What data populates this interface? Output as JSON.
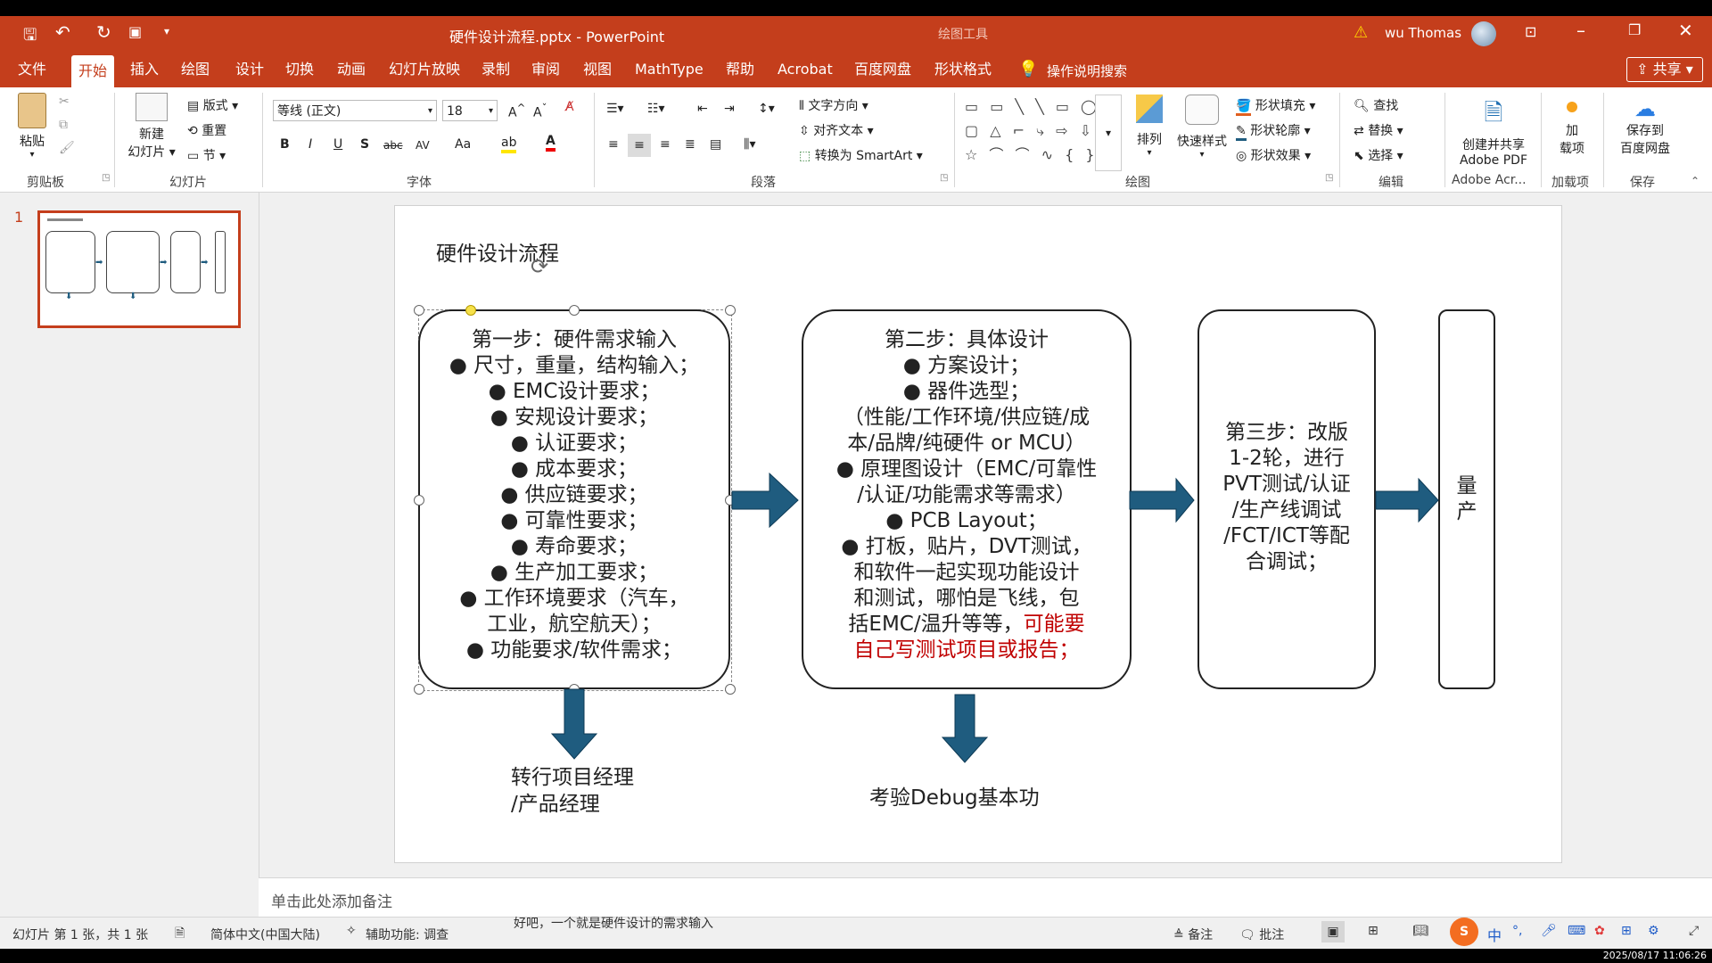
{
  "window": {
    "title": "硬件设计流程.pptx - PowerPoint",
    "context_tool": "绘图工具",
    "user": "wu Thomas",
    "qat": {
      "save": "save-icon",
      "undo": "undo-icon",
      "redo": "redo-icon"
    }
  },
  "tabs": [
    "文件",
    "开始",
    "插入",
    "绘图",
    "设计",
    "切换",
    "动画",
    "幻灯片放映",
    "录制",
    "审阅",
    "视图",
    "MathType",
    "帮助",
    "Acrobat",
    "百度网盘",
    "形状格式"
  ],
  "active_tab": "开始",
  "tell_me": "操作说明搜索",
  "share": "共享",
  "ribbon": {
    "clipboard": {
      "paste": "粘贴",
      "label": "剪贴板"
    },
    "slides": {
      "new_slide_1": "新建",
      "new_slide_2": "幻灯片",
      "layout": "版式",
      "reset": "重置",
      "section": "节",
      "label": "幻灯片"
    },
    "font": {
      "name": "等线 (正文)",
      "size": "18",
      "bold": "B",
      "italic": "I",
      "underline": "U",
      "shadow": "S",
      "strike": "abc",
      "spacing": "AV",
      "case": "Aa",
      "label": "字体"
    },
    "paragraph": {
      "text_direction": "文字方向",
      "align_text": "对齐文本",
      "smartart": "转换为 SmartArt",
      "label": "段落"
    },
    "drawing": {
      "arrange": "排列",
      "quick_styles": "快速样式",
      "fill": "形状填充",
      "outline": "形状轮廓",
      "effects": "形状效果",
      "label": "绘图"
    },
    "editing": {
      "find": "查找",
      "replace": "替换",
      "select": "选择",
      "label": "编辑"
    },
    "adobe": {
      "line1": "创建并共享",
      "line2": "Adobe PDF",
      "label": "Adobe Acr..."
    },
    "addins": {
      "line1": "加",
      "line2": "载项",
      "label": "加载项"
    },
    "save": {
      "line1": "保存到",
      "line2": "百度网盘",
      "label": "保存"
    }
  },
  "thumbnail": {
    "number": "1"
  },
  "slide": {
    "title": "硬件设计流程",
    "step1": {
      "lines": [
        "第一步：硬件需求输入",
        "●  尺寸，重量，结构输入；",
        "●  EMC设计要求；",
        "●  安规设计要求；",
        "●  认证要求；",
        "●  成本要求；",
        "●  供应链要求；",
        "●  可靠性要求；",
        "●  寿命要求；",
        "●  生产加工要求；",
        "●  工作环境要求（汽车，",
        "工业，航空航天）；",
        "●  功能要求/软件需求；"
      ]
    },
    "step2": {
      "lines": [
        "第二步：具体设计",
        "●  方案设计；",
        "●  器件选型；",
        "（性能/工作环境/供应链/成",
        "本/品牌/纯硬件 or MCU）",
        "●  原理图设计（EMC/可靠性",
        "/认证/功能需求等需求）",
        "●  PCB Layout；",
        "●  打板，贴片，DVT测试，",
        "和软件一起实现功能设计",
        "和测试，哪怕是飞线，包"
      ],
      "mixed_prefix": "括EMC/温升等等，",
      "mixed_red": "可能要",
      "last_red": "自己写测试项目或报告；",
      "red_color": "#C00000"
    },
    "step3": {
      "lines": [
        "第三步：改版",
        "1-2轮，进行",
        "PVT测试/认证",
        "/生产线调试",
        "/FCT/ICT等配",
        "合调试；"
      ]
    },
    "step4": {
      "lines": [
        "量",
        "产"
      ]
    },
    "below1": [
      "转行项目经理",
      "/产品经理"
    ],
    "below2": "考验Debug基本功",
    "arrow_color": "#1F5C7F"
  },
  "notes_placeholder": "单击此处添加备注",
  "status": {
    "slide_info": "幻灯片 第 1 张，共 1 张",
    "language": "简体中文(中国大陆)",
    "accessibility": "辅助功能: 调查",
    "notes": "备注",
    "comments": "批注"
  },
  "subtitle": "好吧，一个就是硬件设计的需求输入",
  "clock": "2025/08/17 11:06:26",
  "ime": "中"
}
